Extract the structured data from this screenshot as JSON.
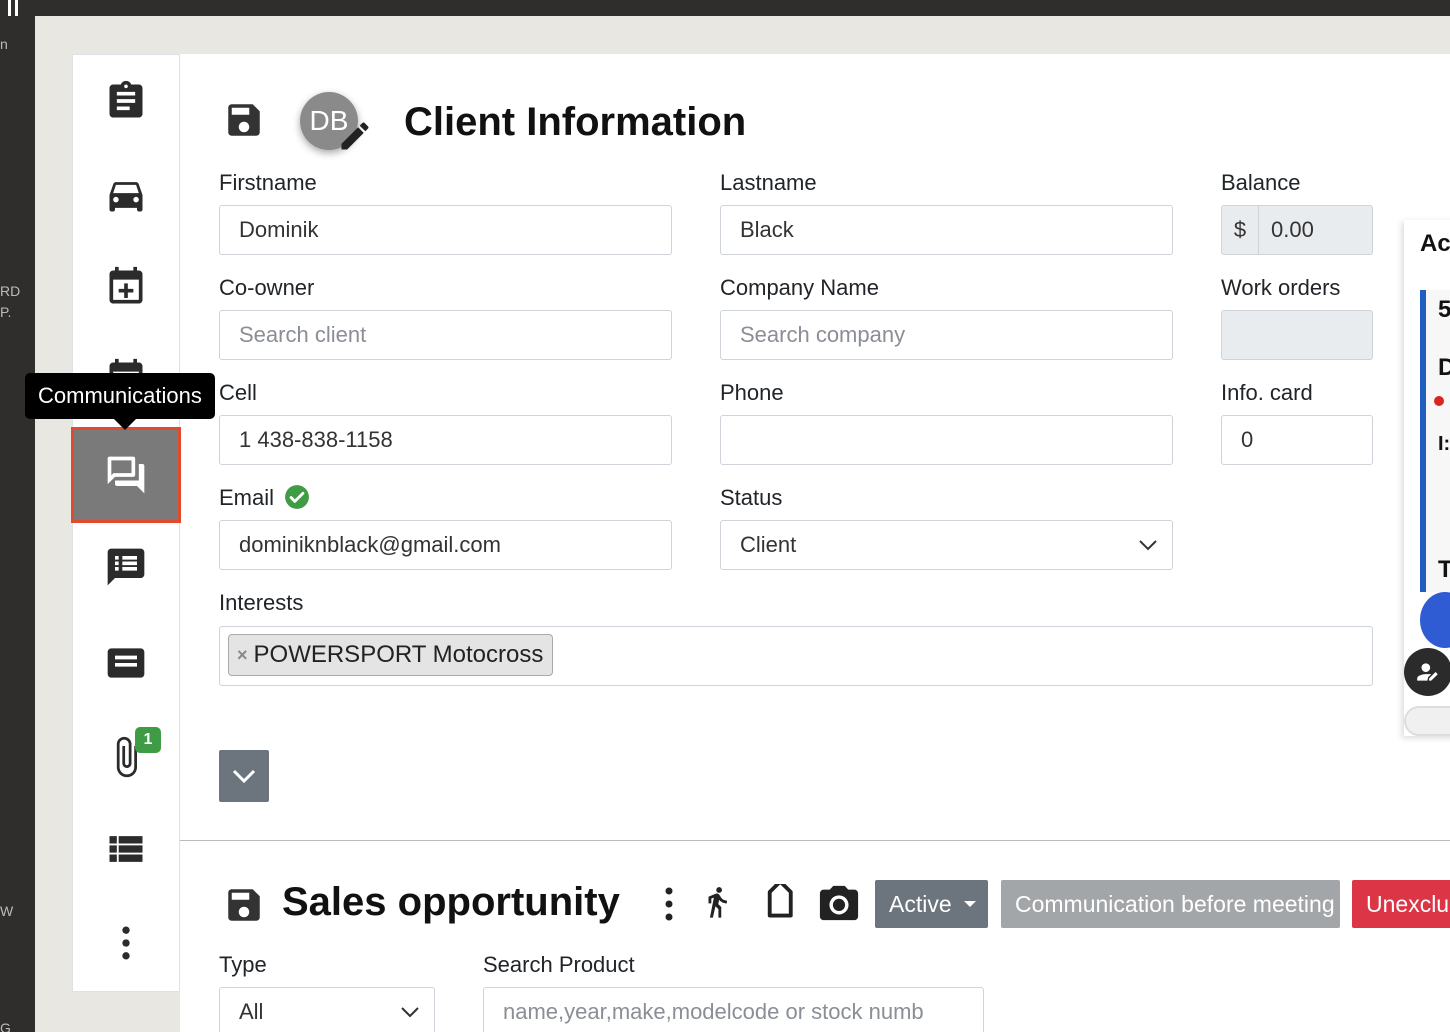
{
  "left_strip": {
    "fragments": [
      "n",
      "RD",
      "P.",
      "W",
      "G"
    ]
  },
  "sidebar": {
    "tooltip": "Communications",
    "items": [
      {
        "name": "work-orders",
        "icon": "clipboard-list-icon"
      },
      {
        "name": "vehicles",
        "icon": "car-icon"
      },
      {
        "name": "add-appointment",
        "icon": "calendar-plus-icon"
      },
      {
        "name": "calendar",
        "icon": "calendar-icon"
      },
      {
        "name": "communications",
        "icon": "forum-icon",
        "active": true
      },
      {
        "name": "notes",
        "icon": "comment-list-icon"
      },
      {
        "name": "messages",
        "icon": "message-icon"
      },
      {
        "name": "attachments",
        "icon": "paperclip-icon",
        "badge": "1"
      },
      {
        "name": "list",
        "icon": "list-icon"
      },
      {
        "name": "more",
        "icon": "more-vertical-icon"
      }
    ]
  },
  "client": {
    "title": "Client Information",
    "avatar_initials": "DB",
    "fields": {
      "firstname": {
        "label": "Firstname",
        "value": "Dominik"
      },
      "lastname": {
        "label": "Lastname",
        "value": "Black"
      },
      "balance": {
        "label": "Balance",
        "currency": "$",
        "value": "0.00"
      },
      "coowner": {
        "label": "Co-owner",
        "placeholder": "Search client"
      },
      "company": {
        "label": "Company Name",
        "placeholder": "Search company"
      },
      "work_orders": {
        "label": "Work orders",
        "value": ""
      },
      "cell": {
        "label": "Cell",
        "value": "1 438-838-1158"
      },
      "phone": {
        "label": "Phone",
        "value": ""
      },
      "info_card": {
        "label": "Info. card",
        "value": "0"
      },
      "email": {
        "label": "Email",
        "value": "dominiknblack@gmail.com",
        "verified": true
      },
      "status": {
        "label": "Status",
        "value": "Client"
      },
      "interests": {
        "label": "Interests",
        "tags": [
          "POWERSPORT Motocross"
        ],
        "remove_symbol": "×"
      }
    }
  },
  "sales": {
    "title": "Sales opportunity",
    "buttons": {
      "active": "Active",
      "comm_before_meeting": "Communication before meeting",
      "unexclude": "Unexclu"
    },
    "type": {
      "label": "Type",
      "value": "All"
    },
    "search_product": {
      "label": "Search Product",
      "placeholder": "name,year,make,modelcode or stock numb"
    }
  },
  "right_panel": {
    "title": "Ac",
    "card_lines": [
      "5",
      "D",
      "I:",
      "T"
    ]
  },
  "colors": {
    "active_outline": "#e24a2e",
    "badge": "#3f9c45",
    "verified": "#3f9c45",
    "btn_gray": "#6c757d",
    "btn_light_gray": "#a3a6a9",
    "btn_danger": "#dc3545"
  }
}
